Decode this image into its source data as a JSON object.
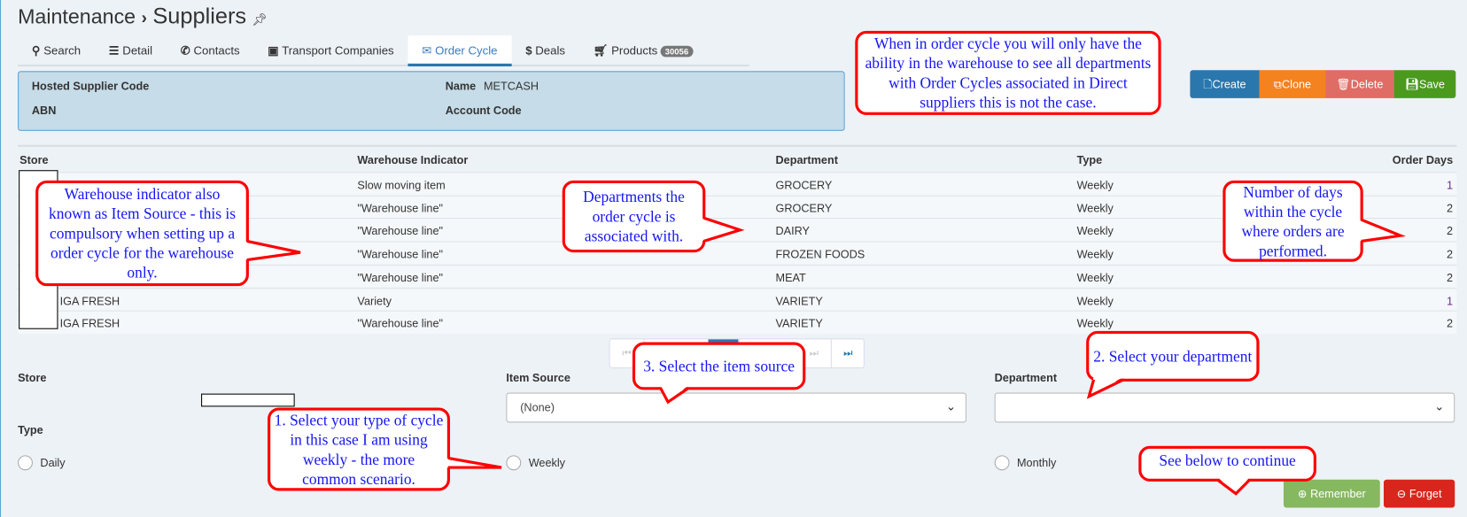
{
  "header": {
    "section": "Maintenance",
    "separator": "›",
    "page": "Suppliers",
    "pin_icon": "pin-icon"
  },
  "tabs": [
    {
      "label": "Search",
      "icon": "search-icon",
      "glyph": "🔍︎"
    },
    {
      "label": "Detail",
      "icon": "list-icon",
      "glyph": "☰"
    },
    {
      "label": "Contacts",
      "icon": "phone-icon",
      "glyph": "✆"
    },
    {
      "label": "Transport Companies",
      "icon": "bus-icon",
      "glyph": "▣"
    },
    {
      "label": "Order Cycle",
      "icon": "envelope-icon",
      "glyph": "✉",
      "active": true
    },
    {
      "label": "Deals",
      "icon": "dollar-icon",
      "glyph": "$"
    },
    {
      "label": "Products",
      "icon": "cart-icon",
      "glyph": "🛒︎",
      "badge": "30056"
    }
  ],
  "info": {
    "hosted_supplier_code_label": "Hosted Supplier Code",
    "name_label": "Name",
    "name_value": "METCASH",
    "abn_label": "ABN",
    "account_code_label": "Account Code"
  },
  "actions": {
    "create": "Create",
    "clone": "Clone",
    "delete": "Delete",
    "save": "Save",
    "colors": {
      "create": "#2a77ad",
      "clone": "#f3821f",
      "delete": "#e06c66",
      "save": "#4a9a1d"
    }
  },
  "table": {
    "columns": [
      "Store",
      "Warehouse Indicator",
      "Department",
      "Type",
      "Order Days"
    ],
    "rows": [
      {
        "store": "",
        "indicator": "Slow moving item",
        "department": "GROCERY",
        "type": "Weekly",
        "days": "1"
      },
      {
        "store": "",
        "indicator": "\"Warehouse line\"",
        "department": "GROCERY",
        "type": "Weekly",
        "days": "2"
      },
      {
        "store": "",
        "indicator": "\"Warehouse line\"",
        "department": "DAIRY",
        "type": "Weekly",
        "days": "2"
      },
      {
        "store": "",
        "indicator": "\"Warehouse line\"",
        "department": "FROZEN FOODS",
        "type": "Weekly",
        "days": "2"
      },
      {
        "store": "",
        "indicator": "\"Warehouse line\"",
        "department": "MEAT",
        "type": "Weekly",
        "days": "2"
      },
      {
        "store": "IGA FRESH",
        "indicator": "Variety",
        "department": "VARIETY",
        "type": "Weekly",
        "days": "1"
      },
      {
        "store": "IGA FRESH",
        "indicator": "\"Warehouse line\"",
        "department": "VARIETY",
        "type": "Weekly",
        "days": "2"
      }
    ]
  },
  "pagination": {
    "first": "⏮",
    "last": "⏭",
    "next": "⏭"
  },
  "form": {
    "store_label": "Store",
    "item_source_label": "Item Source",
    "item_source_value": "(None)",
    "department_label": "Department",
    "department_value": "",
    "type_label": "Type",
    "type_options": [
      "Daily",
      "Weekly",
      "Monthly"
    ],
    "remember": "Remember",
    "forget": "Forget"
  },
  "callouts": {
    "top": "When in order cycle you will only have the ability in the warehouse to see all departments with Order Cycles associated in Direct suppliers this is not the case.",
    "warehouse": "Warehouse indicator also known as Item Source - this is compulsory when setting up a order cycle for the warehouse only.",
    "departments": "Departments the order cycle is associated with.",
    "days": "Number of days within the cycle where orders are performed.",
    "item_source": "3. Select the item source",
    "department": "2. Select your department",
    "type": "1. Select your type of cycle in this case I am using weekly - the more common scenario.",
    "continue": "See below to continue"
  }
}
